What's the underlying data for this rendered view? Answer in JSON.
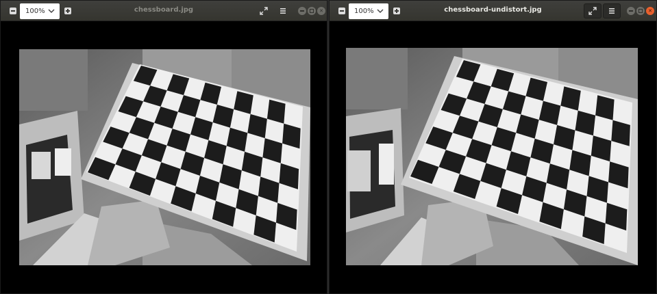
{
  "windows": [
    {
      "id": "left",
      "title": "chessboard.jpg",
      "zoom": "100%",
      "focused": false,
      "image_alt": "chessboard.jpg"
    },
    {
      "id": "right",
      "title": "chessboard-undistort.jpg",
      "zoom": "100%",
      "focused": true,
      "image_alt": "chessboard-undistort.jpg"
    }
  ],
  "icons": {
    "zoom_out": "zoom-out-icon",
    "zoom_in": "zoom-in-icon",
    "zoom_dropdown": "chevron-down-icon",
    "fullscreen": "fullscreen-icon",
    "menu": "hamburger-menu-icon",
    "minimize": "minimize-icon",
    "maximize": "maximize-icon",
    "close": "close-icon"
  },
  "colors": {
    "titlebar": "#3a3a36",
    "close_active": "#e9602d",
    "viewer_background": "#000000"
  }
}
